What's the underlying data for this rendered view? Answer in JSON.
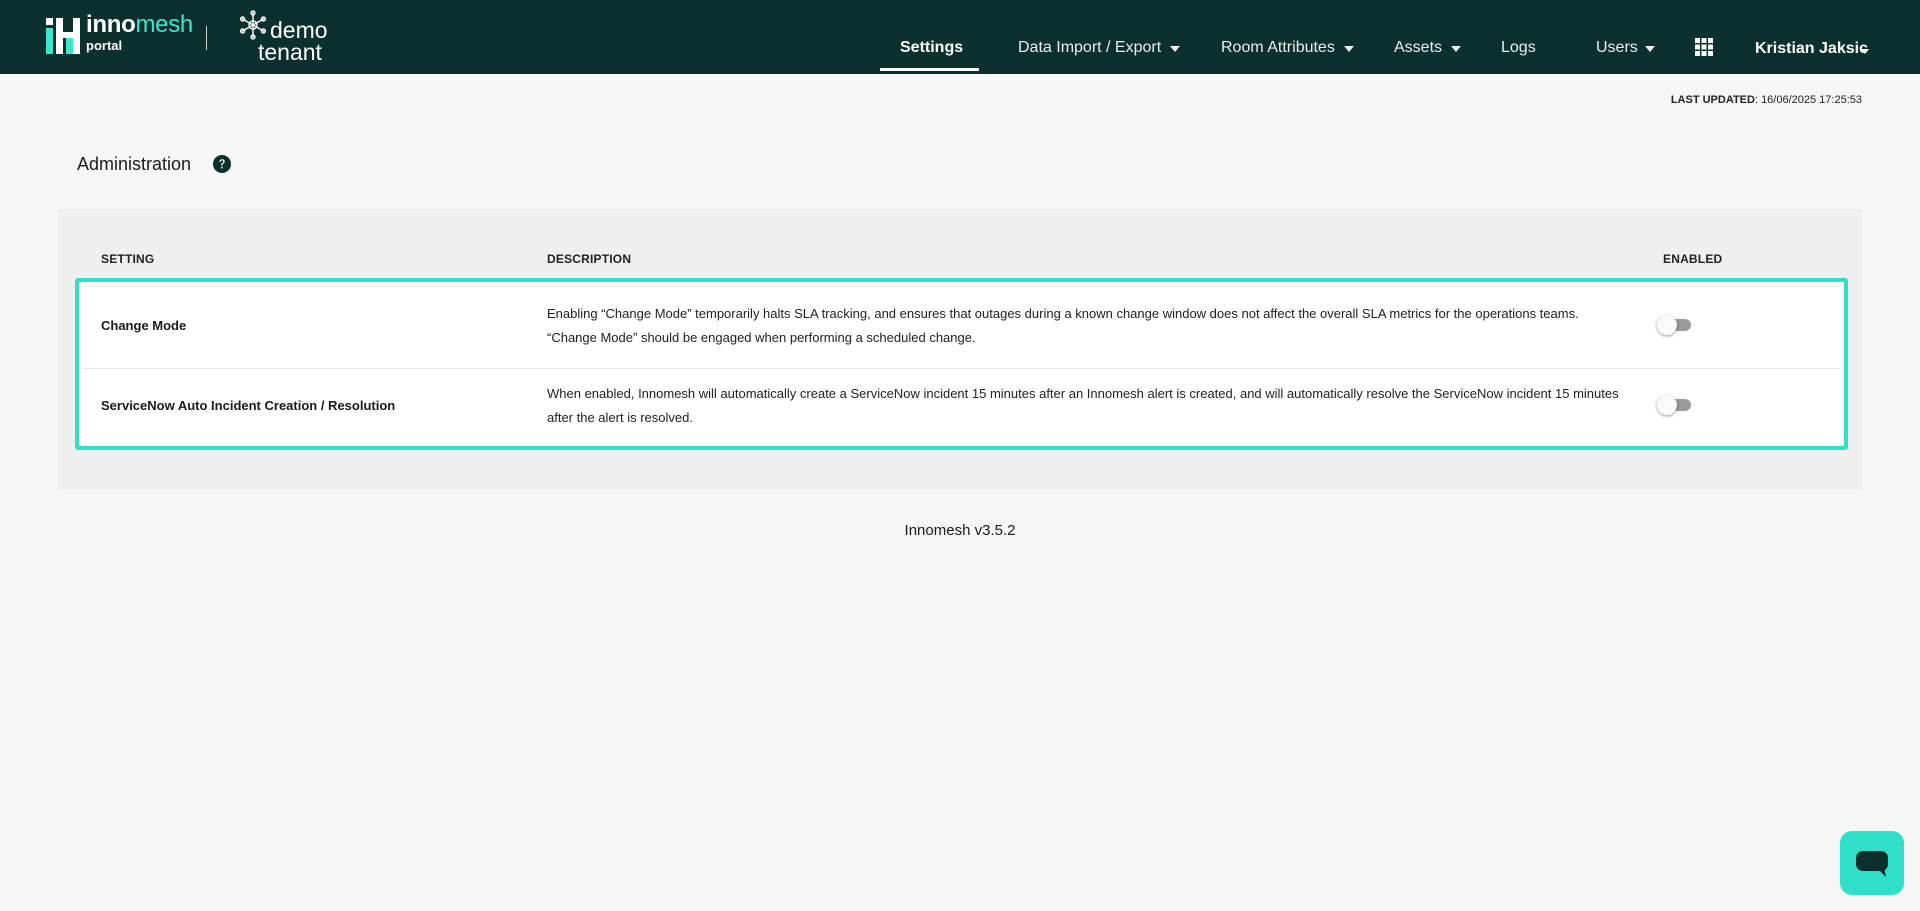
{
  "header": {
    "logo_inno": "inno",
    "logo_mesh": "mesh",
    "logo_sub": "portal",
    "tenant_line1": "demo",
    "tenant_line2": "tenant",
    "nav": [
      {
        "label": "Settings",
        "active": true
      },
      {
        "label": "Data Import / Export",
        "dropdown": true
      },
      {
        "label": "Room Attributes",
        "dropdown": true
      },
      {
        "label": "Assets",
        "dropdown": true
      },
      {
        "label": "Logs"
      },
      {
        "label": "Users",
        "dropdown": true
      }
    ],
    "apps_icon": "grid-icon",
    "user_name": "Kristian Jaksic"
  },
  "last_updated": {
    "label": "LAST UPDATED",
    "value": ": 16/06/2025 17:25:53"
  },
  "page": {
    "title": "Administration",
    "help_icon": "question-circle-icon"
  },
  "table": {
    "columns": [
      "SETTING",
      "DESCRIPTION",
      "ENABLED"
    ],
    "rows": [
      {
        "setting": "Change Mode",
        "description": "Enabling “Change Mode” temporarily halts SLA tracking, and ensures that outages during a known change window does not affect the overall SLA metrics for the operations teams. “Change Mode” should be engaged when performing a scheduled change.",
        "enabled": false
      },
      {
        "setting": "ServiceNow Auto Incident Creation / Resolution",
        "description": "When enabled, Innomesh will automatically create a ServiceNow incident 15 minutes after an Innomesh alert is created, and will automatically resolve the ServiceNow incident 15 minutes after the alert is resolved.",
        "enabled": false
      }
    ]
  },
  "footer": {
    "version": "Innomesh v3.5.2"
  },
  "chat": {
    "icon": "chat-bubble-icon"
  },
  "colors": {
    "header_bg": "#0b302e",
    "accent": "#30dfc7",
    "page_bg": "#f6f6f6"
  }
}
